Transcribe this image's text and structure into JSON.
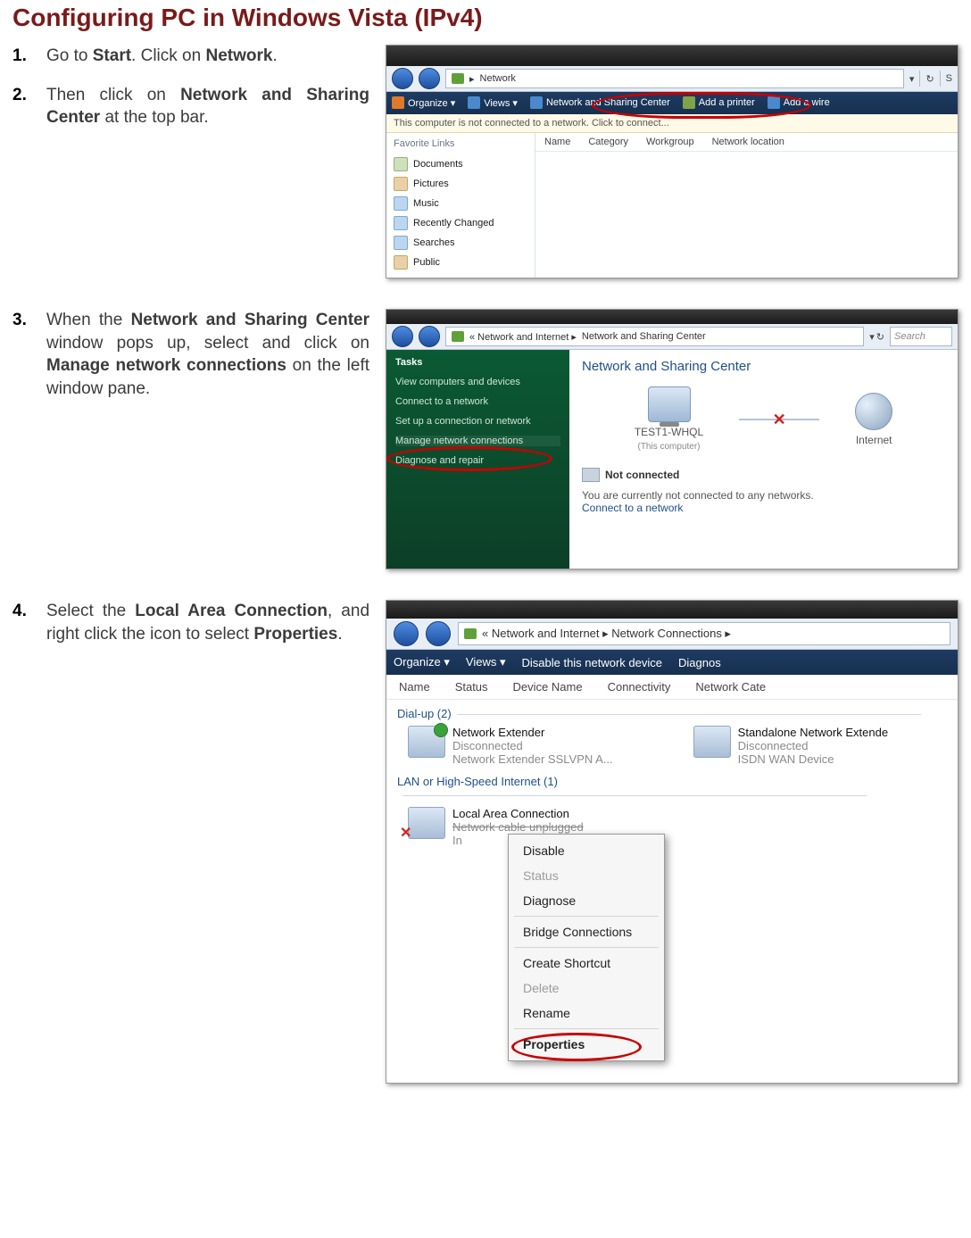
{
  "title": "Configuring PC in Windows Vista (IPv4)",
  "steps": {
    "s1": {
      "num": "1.",
      "pre": "Go to ",
      "b1": "Start",
      "mid": ". Click on ",
      "b2": "Network",
      "post": "."
    },
    "s2": {
      "num": "2.",
      "pre": "Then click on ",
      "b1": "Network and Sharing Center",
      "post": " at the top bar."
    },
    "s3": {
      "num": "3.",
      "pre": "When the ",
      "b1": "Network and Sharing Center",
      "mid": " window pops up, select and click on ",
      "b2": "Manage network connections",
      "post": " on the left window pane."
    },
    "s4": {
      "num": "4.",
      "pre": "Select the ",
      "b1": "Local Area Connection",
      "mid": ", and right click the icon to select ",
      "b2": "Properties",
      "post": "."
    }
  },
  "shot1": {
    "breadcrumb": "Network",
    "addr_tail": {
      "drop": "▾",
      "refresh": "↻"
    },
    "toolbar": {
      "organize": "Organize  ▾",
      "views": "Views   ▾",
      "nsc": "Network and Sharing Center",
      "addprinter": "Add a printer",
      "addwire": "Add a wire"
    },
    "infobar": "This computer is not connected to a network. Click to connect...",
    "side_header": "Favorite Links",
    "side_items": [
      "Documents",
      "Pictures",
      "Music",
      "Recently Changed",
      "Searches",
      "Public"
    ],
    "columns": [
      "Name",
      "Category",
      "Workgroup",
      "Network location"
    ]
  },
  "shot2": {
    "breadcrumb_pre": "«  Network and Internet  ▸  ",
    "breadcrumb": "Network and Sharing Center",
    "search_placeholder": "Search",
    "addr_tail": {
      "drop": "▾",
      "refresh": "↻"
    },
    "tasks_header": "Tasks",
    "tasks": [
      "View computers and devices",
      "Connect to a network",
      "Set up a connection or network",
      "Manage network connections",
      "Diagnose and repair"
    ],
    "main_title": "Network and Sharing Center",
    "node_pc": "TEST1-WHQL",
    "node_pc_sub": "(This computer)",
    "node_net": "Internet",
    "xmark": "✕",
    "not_connected": "Not connected",
    "msg": "You are currently not connected to any networks.",
    "link": "Connect to a network"
  },
  "shot3": {
    "breadcrumb": "«   Network and Internet  ▸  Network Connections  ▸",
    "toolbar": {
      "organize": "Organize  ▾",
      "views": "Views   ▾",
      "disable": "Disable this network device",
      "diagnose": "Diagnos"
    },
    "columns": [
      "Name",
      "Status",
      "Device Name",
      "Connectivity",
      "Network Cate"
    ],
    "group1": "Dial-up (2)",
    "conn1": {
      "name": "Network Extender",
      "status": "Disconnected",
      "dev": "Network Extender SSLVPN A..."
    },
    "conn2": {
      "name": "Standalone Network Extende",
      "status": "Disconnected",
      "dev": "ISDN WAN Device"
    },
    "group2": "LAN or High-Speed Internet (1)",
    "conn3": {
      "name": "Local Area Connection",
      "status": "Network cable unplugged",
      "dev": "In"
    },
    "ctx": [
      "Disable",
      "Status",
      "Diagnose",
      "__sep",
      "Bridge Connections",
      "__sep",
      "Create Shortcut",
      "Delete",
      "Rename",
      "__sep",
      "Properties"
    ],
    "ctx_disabled": [
      "Status",
      "Delete"
    ],
    "ctx_selected": "Properties"
  }
}
